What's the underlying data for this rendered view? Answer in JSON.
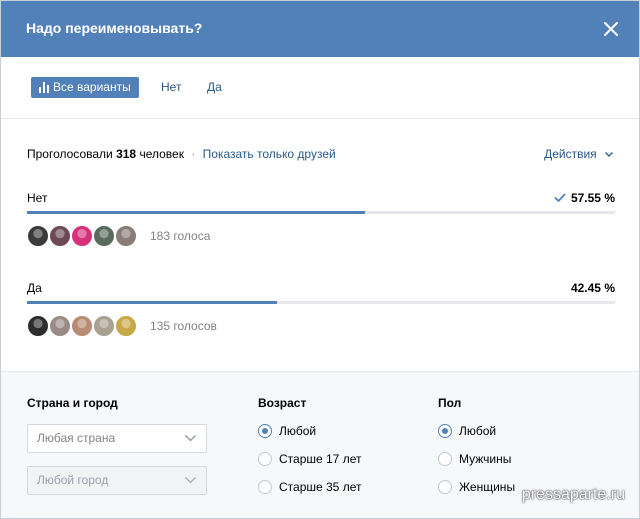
{
  "header": {
    "title": "Надо переименовывать?"
  },
  "tabs": {
    "all": "Все варианты",
    "no": "Нет",
    "yes": "Да"
  },
  "summary": {
    "prefix": "Проголосовали",
    "count": "318",
    "suffix": "человек",
    "separator": "·",
    "friends_link": "Показать только друзей",
    "actions": "Действия"
  },
  "options": [
    {
      "label": "Нет",
      "percent_text": "57.55 %",
      "fraction": 0.5755,
      "votes_text": "183 голоса",
      "checked": true,
      "avatar_colors": [
        "#3b3b3b",
        "#6b4a55",
        "#d8317b",
        "#5a6b5e",
        "#8a7d78"
      ]
    },
    {
      "label": "Да",
      "percent_text": "42.45 %",
      "fraction": 0.4245,
      "votes_text": "135 голосов",
      "checked": false,
      "avatar_colors": [
        "#2e2e2e",
        "#9a8a86",
        "#b98a74",
        "#a8a090",
        "#c9a84a"
      ]
    }
  ],
  "filters": {
    "location": {
      "title": "Страна и город",
      "country_placeholder": "Любая страна",
      "city_placeholder": "Любой город"
    },
    "age": {
      "title": "Возраст",
      "options": [
        "Любой",
        "Старше 17 лет",
        "Старше 35 лет"
      ],
      "selected": 0
    },
    "gender": {
      "title": "Пол",
      "options": [
        "Любой",
        "Мужчины",
        "Женщины"
      ],
      "selected": 0
    }
  },
  "watermark": "pressaparte.ru",
  "colors": {
    "accent": "#5181b8",
    "link": "#2a5885",
    "muted": "#828282",
    "track": "#e7e8ec"
  }
}
